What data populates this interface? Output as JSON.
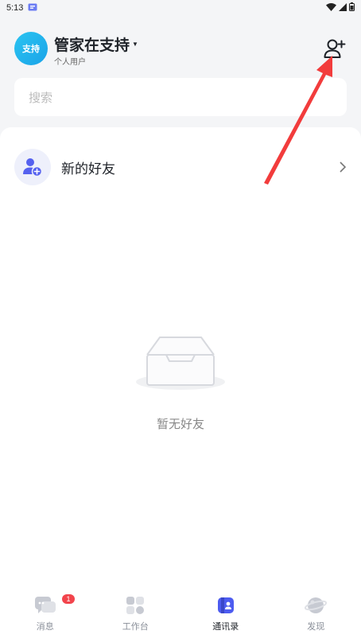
{
  "status_bar": {
    "time": "5:13"
  },
  "header": {
    "avatar_text": "支持",
    "user_name": "管家在支持",
    "user_type": "个人用户",
    "add_friend_icon": "add-user-icon"
  },
  "search": {
    "placeholder": "搜索"
  },
  "contacts": {
    "new_friends_label": "新的好友",
    "empty_text": "暂无好友"
  },
  "tabbar": {
    "tabs": [
      {
        "label": "消息",
        "icon": "message-icon",
        "badge": "1",
        "active": false
      },
      {
        "label": "工作台",
        "icon": "workbench-icon",
        "active": false
      },
      {
        "label": "通讯录",
        "icon": "contacts-icon",
        "active": true
      },
      {
        "label": "发现",
        "icon": "planet-icon",
        "active": false
      }
    ]
  },
  "colors": {
    "accent": "#4d5cf0",
    "annotation_arrow": "#f23c3c",
    "badge": "#f2444c"
  }
}
